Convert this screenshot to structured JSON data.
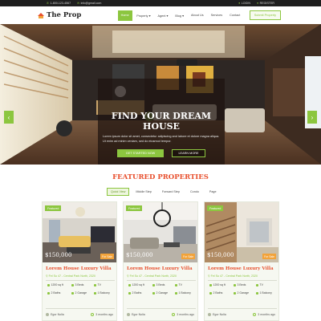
{
  "topbar": {
    "phone": "1-800-123-4567",
    "email": "info@gmail.com",
    "login": "LOGIN",
    "register": "REGISTER"
  },
  "nav": {
    "logo": "The Prop",
    "items": [
      "Home",
      "Property ▾",
      "Agent ▾",
      "Blog ▾",
      "About Us",
      "Services",
      "Contact"
    ],
    "submit": "Submit Property"
  },
  "hero": {
    "title_line1": "FIND YOUR DREAM",
    "title_line2": "HOUSE",
    "text": "Lorem ipsum dolor sit amet, consectetur adipiscing and labore et dolore magna aliqua. Ut enim ad minim veniam, sed do eiusmod tempor.",
    "btn_primary": "GET STARTED NOW",
    "btn_secondary": "LEARN MORE",
    "arrow_left": "‹",
    "arrow_right": "›"
  },
  "featured": {
    "title": "FEATURED PROPERTIES",
    "tabs": [
      "Quick View",
      "Middle Step",
      "Forward Step",
      "Condo",
      "Page"
    ]
  },
  "cards": [
    {
      "badge": "Featured",
      "tag": "For Sale",
      "price": "$150,000",
      "title": "Lorem House Luxury Villa",
      "address": "Fel Su 47 - Central Park North, 2320",
      "area": "1200 sq ft",
      "beds": "3 Beds",
      "tv": "TV",
      "baths": "2 Baths",
      "garage": "2 Garage",
      "balcony": "1 Balcony",
      "agent": "Egor Nolla",
      "time": "3 months ago"
    },
    {
      "badge": "Featured",
      "tag": "For Sale",
      "price": "$150,000",
      "title": "Lorem House Luxury Villa",
      "address": "Fel Su 47 - Central Park North, 2320",
      "area": "1200 sq ft",
      "beds": "3 Beds",
      "tv": "TV",
      "baths": "2 Baths",
      "garage": "2 Garage",
      "balcony": "1 Balcony",
      "agent": "Egor Nolla",
      "time": "3 months ago"
    },
    {
      "badge": "Featured",
      "tag": "For Sale",
      "price": "$150,000",
      "title": "Lorem House Luxury Villa",
      "address": "Fel Su 47 - Central Park North, 2320",
      "area": "1200 sq ft",
      "beds": "3 Beds",
      "tv": "TV",
      "baths": "2 Baths",
      "garage": "2 Garage",
      "balcony": "1 Balcony",
      "agent": "Egor Nolla",
      "time": "3 months ago"
    }
  ],
  "colors": {
    "accent": "#8cc63f",
    "brand": "#e8502e",
    "topbar": "#1e1e1e"
  },
  "icons": [
    "phone-icon",
    "mail-icon",
    "user-icon",
    "chevron-left-icon",
    "chevron-right-icon",
    "location-pin-icon",
    "area-icon",
    "bed-icon",
    "tv-icon",
    "bath-icon",
    "garage-icon",
    "balcony-icon",
    "clock-icon"
  ]
}
